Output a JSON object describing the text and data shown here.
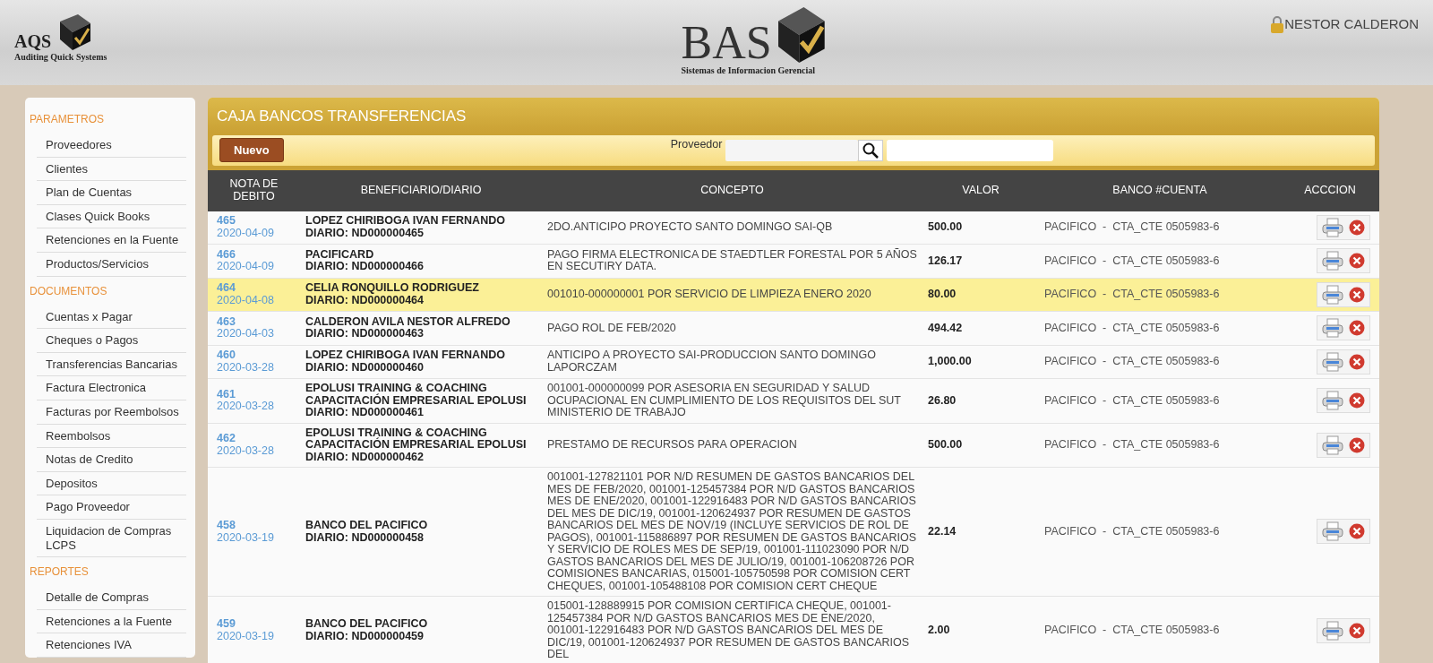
{
  "header": {
    "left_logo": {
      "title": "AQS",
      "subtitle": "Auditing Quick Systems"
    },
    "center_logo": {
      "title": "BAS",
      "subtitle": "Sistemas de Informacion Gerencial"
    },
    "user": "NESTOR CALDERON"
  },
  "sidebar": {
    "sections": [
      {
        "title": "PARAMETROS",
        "items": [
          "Proveedores",
          "Clientes",
          "Plan de Cuentas",
          "Clases Quick Books",
          "Retenciones en la Fuente",
          "Productos/Servicios"
        ]
      },
      {
        "title": "DOCUMENTOS",
        "items": [
          "Cuentas x Pagar",
          "Cheques o Pagos",
          "Transferencias Bancarias",
          "Factura Electronica",
          "Facturas por Reembolsos",
          "Reembolsos",
          "Notas de Credito",
          "Depositos",
          "Pago Proveedor",
          "Liquidacion de Compras LCPS"
        ]
      },
      {
        "title": "REPORTES",
        "items": [
          "Detalle de Compras",
          "Retenciones a la Fuente",
          "Retenciones IVA"
        ]
      }
    ]
  },
  "panel": {
    "title": "CAJA BANCOS TRANSFERENCIAS",
    "new_button": "Nuevo",
    "search_label": "Proveedor"
  },
  "table": {
    "columns": [
      "NOTA DE DEBITO",
      "BENEFICIARIO/DIARIO",
      "CONCEPTO",
      "VALOR",
      "BANCO #CUENTA",
      "ACCCION"
    ],
    "rows": [
      {
        "number": "465",
        "date": "2020-04-09",
        "beneficiary": "LOPEZ CHIRIBOGA IVAN FERNANDO",
        "diario": "DIARIO: ND000000465",
        "concept": "2DO.ANTICIPO PROYECTO SANTO DOMINGO SAI-QB",
        "value": "500.00",
        "bank": "PACIFICO  -  CTA_CTE 0505983-6",
        "selected": false
      },
      {
        "number": "466",
        "date": "2020-04-09",
        "beneficiary": "PACIFICARD",
        "diario": "DIARIO: ND000000466",
        "concept": "PAGO FIRMA ELECTRONICA DE STAEDTLER FORESTAL POR 5 AÑOS EN SECUTIRY DATA.",
        "value": "126.17",
        "bank": "PACIFICO  -  CTA_CTE 0505983-6",
        "selected": false
      },
      {
        "number": "464",
        "date": "2020-04-08",
        "beneficiary": "CELIA RONQUILLO RODRIGUEZ",
        "diario": "DIARIO: ND000000464",
        "concept": "001010-000000001 POR SERVICIO DE LIMPIEZA ENERO 2020",
        "value": "80.00",
        "bank": "PACIFICO  -  CTA_CTE 0505983-6",
        "selected": true
      },
      {
        "number": "463",
        "date": "2020-04-03",
        "beneficiary": "CALDERON AVILA NESTOR ALFREDO",
        "diario": "DIARIO: ND000000463",
        "concept": "PAGO ROL DE FEB/2020",
        "value": "494.42",
        "bank": "PACIFICO  -  CTA_CTE 0505983-6",
        "selected": false
      },
      {
        "number": "460",
        "date": "2020-03-28",
        "beneficiary": "LOPEZ CHIRIBOGA IVAN FERNANDO",
        "diario": "DIARIO: ND000000460",
        "concept": "ANTICIPO A PROYECTO SAI-PRODUCCION SANTO DOMINGO LAPORCZAM",
        "value": "1,000.00",
        "bank": "PACIFICO  -  CTA_CTE 0505983-6",
        "selected": false
      },
      {
        "number": "461",
        "date": "2020-03-28",
        "beneficiary": "EPOLUSI TRAINING & COACHING CAPACITACIÓN EMPRESARIAL EPOLUSI",
        "diario": "DIARIO: ND000000461",
        "concept": "001001-000000099 POR ASESORIA EN SEGURIDAD Y SALUD OCUPACIONAL EN CUMPLIMIENTO DE LOS REQUISITOS DEL SUT MINISTERIO DE TRABAJO",
        "value": "26.80",
        "bank": "PACIFICO  -  CTA_CTE 0505983-6",
        "selected": false
      },
      {
        "number": "462",
        "date": "2020-03-28",
        "beneficiary": "EPOLUSI TRAINING & COACHING CAPACITACIÓN EMPRESARIAL EPOLUSI",
        "diario": "DIARIO: ND000000462",
        "concept": "PRESTAMO DE RECURSOS PARA OPERACION",
        "value": "500.00",
        "bank": "PACIFICO  -  CTA_CTE 0505983-6",
        "selected": false
      },
      {
        "number": "458",
        "date": "2020-03-19",
        "beneficiary": "BANCO DEL PACIFICO",
        "diario": "DIARIO: ND000000458",
        "concept": "001001-127821101 POR N/D RESUMEN DE GASTOS BANCARIOS DEL MES DE FEB/2020, 001001-125457384 POR N/D GASTOS BANCARIOS MES DE ENE/2020, 001001-122916483 POR N/D GASTOS BANCARIOS DEL MES DE DIC/19, 001001-120624937 POR RESUMEN DE GASTOS BANCARIOS DEL MES DE NOV/19 (INCLUYE SERVICIOS DE ROL DE PAGOS), 001001-115886897 POR RESUMEN DE GASTOS BANCARIOS Y SERVICIO DE ROLES MES DE SEP/19, 001001-111023090 POR N/D GASTOS BANCARIOS DEL MES DE JULIO/19, 001001-106208726 POR COMISIONES BANCARIAS, 015001-105750598 POR COMISION CERT CHEQUES, 001001-105488108 POR COMISION CERT CHEQUE",
        "value": "22.14",
        "bank": "PACIFICO  -  CTA_CTE 0505983-6",
        "selected": false
      },
      {
        "number": "459",
        "date": "2020-03-19",
        "beneficiary": "BANCO DEL PACIFICO",
        "diario": "DIARIO: ND000000459",
        "concept": "015001-128889915 POR COMISION CERTIFICA CHEQUE, 001001-125457384 POR N/D GASTOS BANCARIOS MES DE ENE/2020, 001001-122916483 POR N/D GASTOS BANCARIOS DEL MES DE DIC/19, 001001-120624937 POR RESUMEN DE GASTOS BANCARIOS DEL",
        "value": "2.00",
        "bank": "PACIFICO  -  CTA_CTE 0505983-6",
        "selected": false
      }
    ]
  }
}
